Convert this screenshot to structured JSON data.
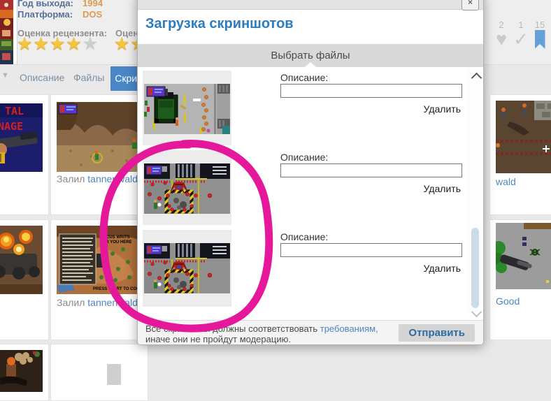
{
  "page": {
    "info": {
      "year_label": "Год выхода:",
      "year_value": "1994",
      "platform_label": "Платформа:",
      "platform_value": "DOS",
      "reviewer_rating_label": "Оценка рецензента:",
      "reviewer_rating_filled": 4,
      "reviewer_rating_total": 5,
      "second_rating_label_fragment": "Оцен"
    },
    "counters": {
      "likes": "2",
      "checks": "1",
      "bookmarks": "15"
    },
    "tabs": [
      {
        "label": "Описание",
        "active": false
      },
      {
        "label": "Файлы",
        "active": false
      },
      {
        "label": "Скрин",
        "active": true
      }
    ],
    "cards": {
      "uploader_prefix": "Залил",
      "uploader_link": "tannenwald",
      "right_row1_fragment": "wald",
      "right_row2_fragment": "Good",
      "cover_line1": "TAL",
      "cover_line2": "NAGE",
      "briefing_heading": "ORCUS WRITS\nFOR YOU HERE",
      "briefing_footer": "PRESS START TO CONTIN"
    }
  },
  "modal": {
    "title": "Загрузка скриншотов",
    "close_label": "×",
    "choose_files_label": "Выбрать файлы",
    "rows": [
      {
        "description_label": "Описание:",
        "input_value": "",
        "delete_label": "Удалить",
        "thumbnail": "street scene with green truck"
      },
      {
        "description_label": "Описание:",
        "input_value": "",
        "delete_label": "Удалить",
        "thumbnail": "factory hazard pit with spider boss (duplicate)"
      },
      {
        "description_label": "Описание:",
        "input_value": "",
        "delete_label": "Удалить",
        "thumbnail": "factory hazard pit with spider boss (duplicate)"
      }
    ],
    "footer": {
      "note_line1_before_link": "Все скриншоты должны соответствовать ",
      "note_link": "требованиям,",
      "note_line2": "иначе они не пройдут модерацию.",
      "submit_label": "Отправить"
    }
  },
  "annotation": {
    "shape": "hand-drawn circle around duplicate screenshots",
    "color": "#e5189b"
  }
}
